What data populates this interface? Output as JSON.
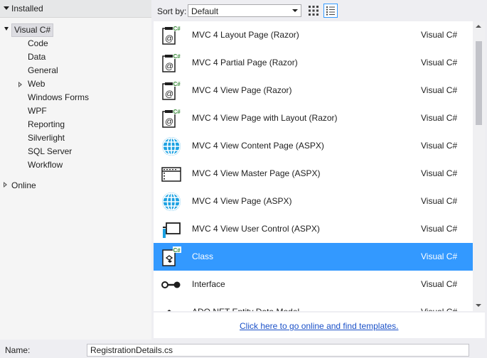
{
  "tree": {
    "installed_label": "Installed",
    "root_label": "Visual C#",
    "children": [
      "Code",
      "Data",
      "General",
      "Web",
      "Windows Forms",
      "WPF",
      "Reporting",
      "Silverlight",
      "SQL Server",
      "Workflow"
    ],
    "online_label": "Online"
  },
  "toolbar": {
    "sort_label": "Sort by:",
    "sort_value": "Default"
  },
  "templates": [
    {
      "name": "MVC 4 Layout Page (Razor)",
      "lang": "Visual C#",
      "icon": "razor-page-icon"
    },
    {
      "name": "MVC 4 Partial Page (Razor)",
      "lang": "Visual C#",
      "icon": "razor-page-icon"
    },
    {
      "name": "MVC 4 View Page (Razor)",
      "lang": "Visual C#",
      "icon": "razor-page-icon"
    },
    {
      "name": "MVC 4 View Page with Layout (Razor)",
      "lang": "Visual C#",
      "icon": "razor-page-icon"
    },
    {
      "name": "MVC 4 View Content Page (ASPX)",
      "lang": "Visual C#",
      "icon": "globe-icon"
    },
    {
      "name": "MVC 4 View Master Page (ASPX)",
      "lang": "Visual C#",
      "icon": "master-page-icon"
    },
    {
      "name": "MVC 4 View Page (ASPX)",
      "lang": "Visual C#",
      "icon": "globe-icon"
    },
    {
      "name": "MVC 4 View User Control (ASPX)",
      "lang": "Visual C#",
      "icon": "user-control-icon"
    },
    {
      "name": "Class",
      "lang": "Visual C#",
      "icon": "class-icon",
      "selected": true
    },
    {
      "name": "Interface",
      "lang": "Visual C#",
      "icon": "interface-icon"
    },
    {
      "name": "ADO.NET Entity Data Model",
      "lang": "Visual C#",
      "icon": "entity-model-icon"
    }
  ],
  "online_link": "Click here to go online and find templates.",
  "name_field": {
    "label": "Name:",
    "value": "RegistrationDetails.cs"
  },
  "colors": {
    "selection": "#3399ff",
    "link": "#1b51c8",
    "csharp_badge": "#3a8a3a"
  }
}
